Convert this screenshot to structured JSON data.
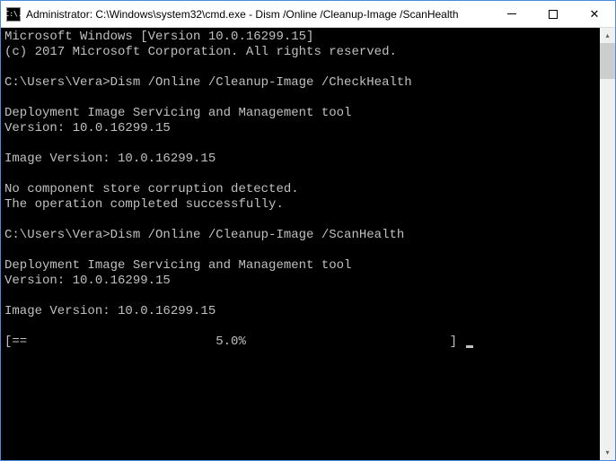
{
  "window": {
    "title": "Administrator: C:\\Windows\\system32\\cmd.exe - Dism  /Online /Cleanup-Image /ScanHealth",
    "icon_label": "C:\\."
  },
  "terminal": {
    "lines": [
      "Microsoft Windows [Version 10.0.16299.15]",
      "(c) 2017 Microsoft Corporation. All rights reserved.",
      "",
      "C:\\Users\\Vera>Dism /Online /Cleanup-Image /CheckHealth",
      "",
      "Deployment Image Servicing and Management tool",
      "Version: 10.0.16299.15",
      "",
      "Image Version: 10.0.16299.15",
      "",
      "No component store corruption detected.",
      "The operation completed successfully.",
      "",
      "C:\\Users\\Vera>Dism /Online /Cleanup-Image /ScanHealth",
      "",
      "Deployment Image Servicing and Management tool",
      "Version: 10.0.16299.15",
      "",
      "Image Version: 10.0.16299.15",
      "",
      "[==                         5.0%                           ] "
    ]
  }
}
